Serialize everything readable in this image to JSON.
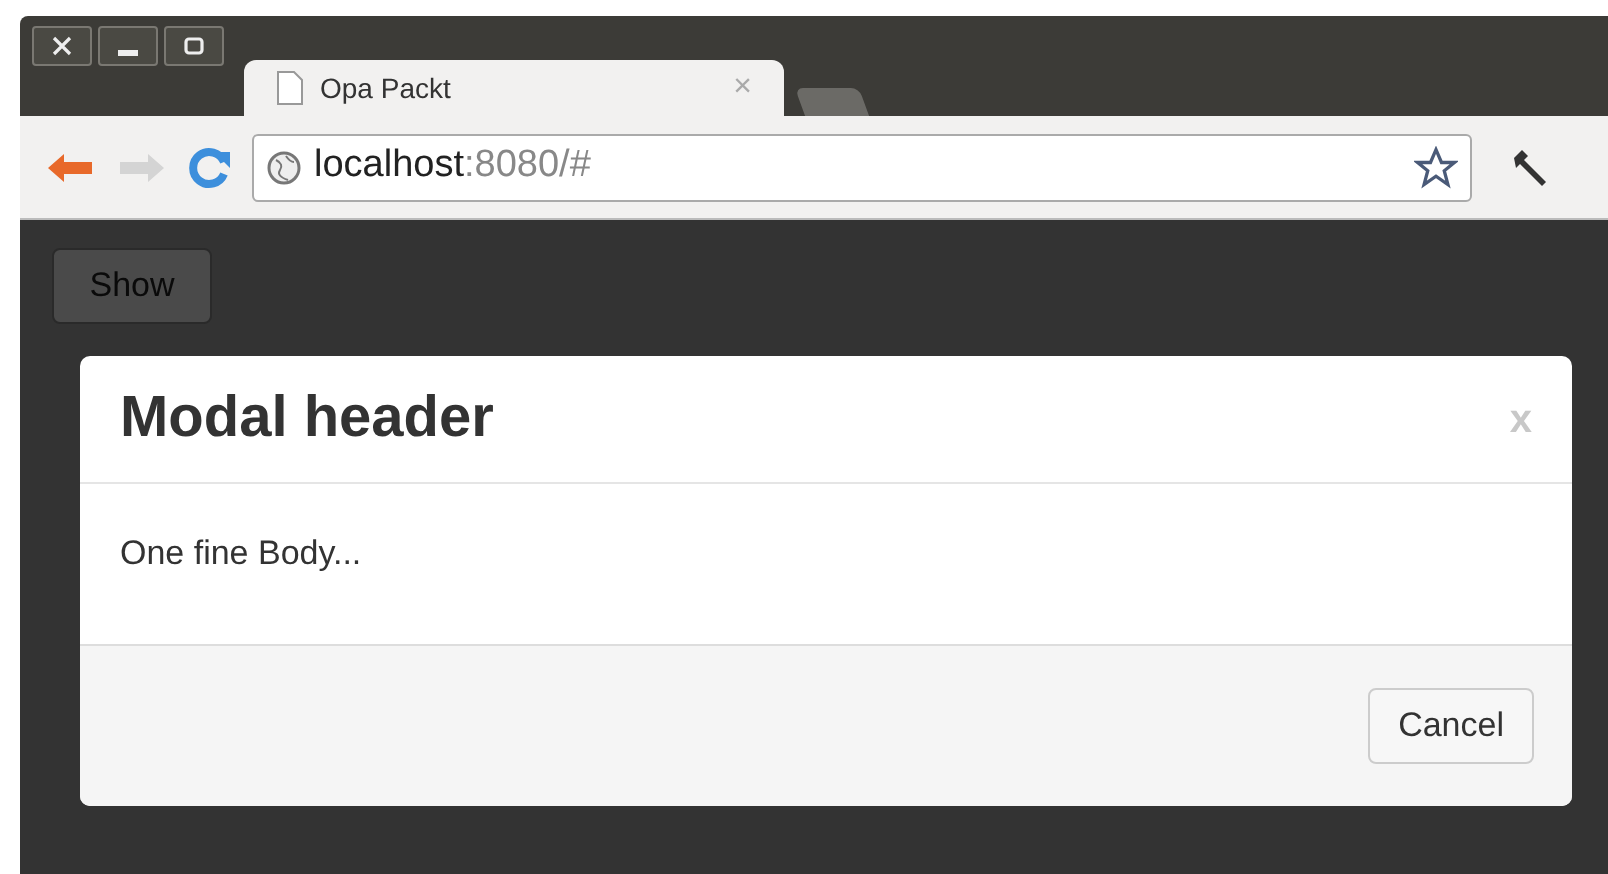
{
  "tab": {
    "title": "Opa Packt",
    "close": "×"
  },
  "address_bar": {
    "host": "localhost",
    "rest": ":8080/#"
  },
  "page": {
    "show_button": "Show"
  },
  "modal": {
    "title": "Modal header",
    "close": "x",
    "body": "One fine Body...",
    "buttons": [
      "Cancel"
    ]
  }
}
